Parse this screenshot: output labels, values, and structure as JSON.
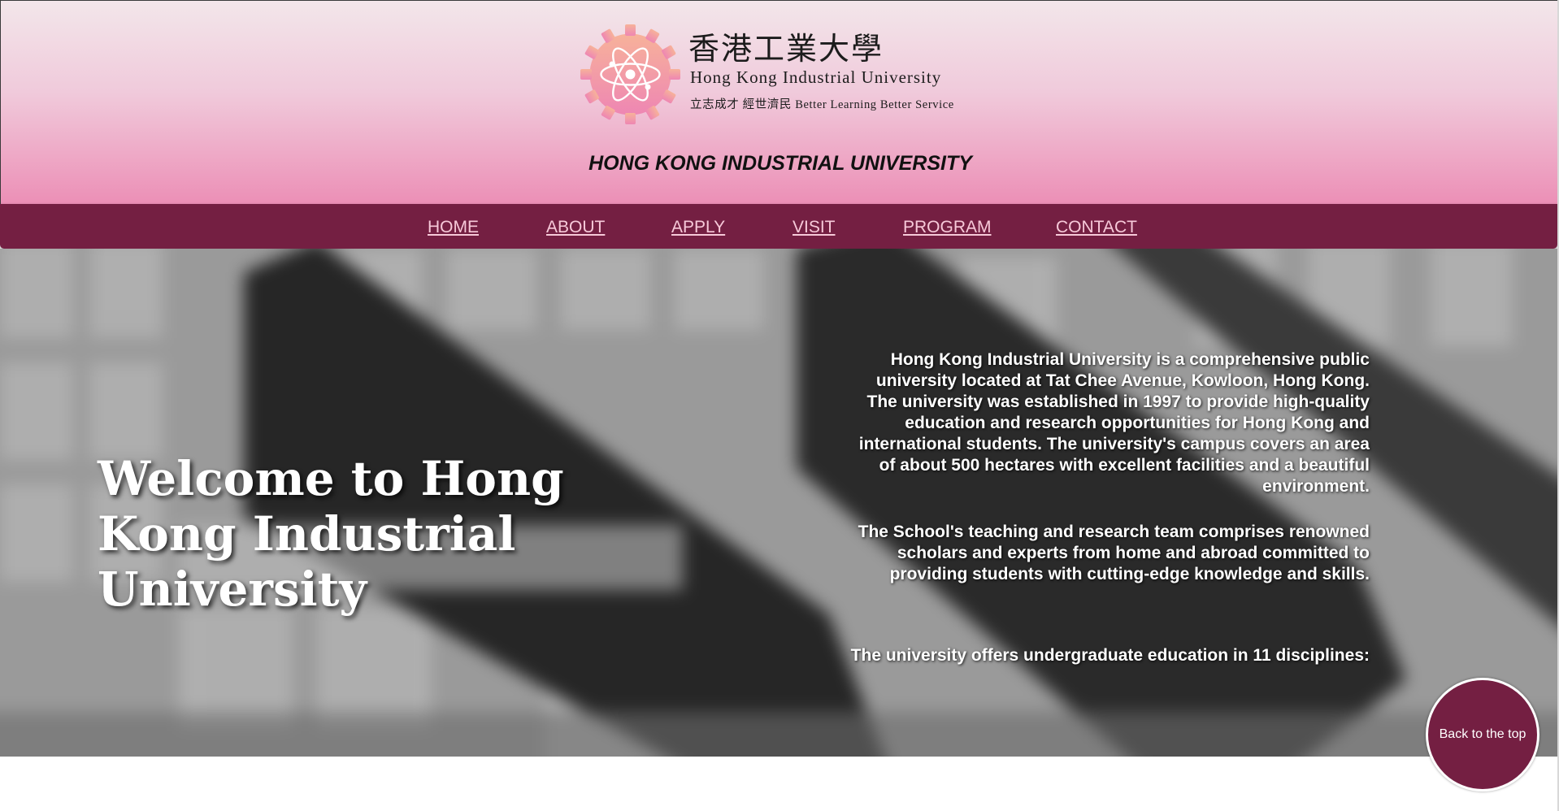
{
  "header": {
    "logo": {
      "cn_name": "香港工業大學",
      "en_name": "Hong Kong Industrial University",
      "motto": "立志成才 經世濟民 Better Learning Better Service"
    },
    "site_title": "HONG KONG INDUSTRIAL UNIVERSITY"
  },
  "nav": {
    "items": [
      {
        "label": "HOME"
      },
      {
        "label": "ABOUT"
      },
      {
        "label": "APPLY"
      },
      {
        "label": "VISIT"
      },
      {
        "label": "PROGRAM"
      },
      {
        "label": "CONTACT"
      }
    ]
  },
  "hero": {
    "title": "Welcome to Hong Kong Industrial University",
    "paragraphs": [
      "Hong Kong Industrial University is a comprehensive public university located at Tat Chee Avenue, Kowloon, Hong Kong. The university was established in 1997 to provide high-quality education and research opportunities for Hong Kong and international students. The university's campus covers an area of about 500 hectares with excellent facilities and a beautiful environment.",
      "The School's teaching and research team comprises renowned scholars and experts from home and abroad committed to providing students with cutting-edge knowledge and skills.",
      "The university offers undergraduate education in 11 disciplines:"
    ]
  },
  "back_to_top": {
    "label": "Back to the top"
  },
  "colors": {
    "nav_background": "#741f42",
    "nav_link": "#f7c9d9",
    "header_gradient_top": "#f3e6ea",
    "header_gradient_bottom": "#ec8fb6",
    "logo_gear": "#f29fb8"
  }
}
